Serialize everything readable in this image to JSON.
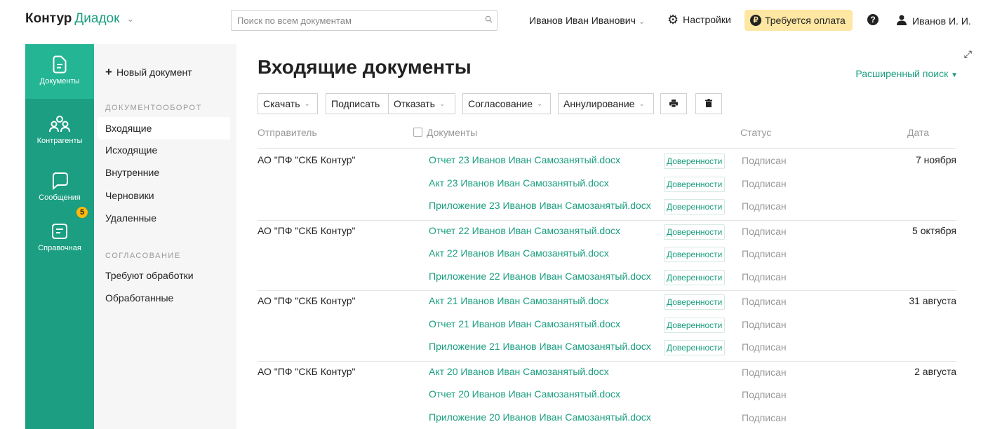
{
  "header": {
    "brand_main": "Контур",
    "brand_sub": "Диадок",
    "search_placeholder": "Поиск по всем документам",
    "org_user": "Иванов Иван Иванович",
    "settings_label": "Настройки",
    "payment_label": "Требуется оплата",
    "account_label": "Иванов И. И."
  },
  "nav": [
    {
      "label": "Документы",
      "icon": "document-icon"
    },
    {
      "label": "Контрагенты",
      "icon": "contacts-icon"
    },
    {
      "label": "Сообщения",
      "icon": "messages-icon"
    },
    {
      "label": "Справочная",
      "icon": "help-book-icon",
      "badge": "5"
    }
  ],
  "sidebar": {
    "new_doc": "Новый документ",
    "section1": "ДОКУМЕНТООБОРОТ",
    "items1": [
      "Входящие",
      "Исходящие",
      "Внутренние",
      "Черновики",
      "Удаленные"
    ],
    "section2": "СОГЛАСОВАНИЕ",
    "items2": [
      "Требуют обработки",
      "Обработанные"
    ]
  },
  "main": {
    "title": "Входящие документы",
    "advanced_search": "Расширенный поиск",
    "toolbar": {
      "download": "Скачать",
      "sign": "Подписать",
      "reject": "Отказать",
      "approval": "Согласование",
      "annul": "Аннулирование"
    },
    "columns": {
      "sender": "Отправитель",
      "documents": "Документы",
      "status": "Статус",
      "date": "Дата"
    },
    "groups": [
      {
        "sender": "АО \"ПФ \"СКБ Контур\"",
        "date": "7 ноября",
        "docs": [
          {
            "name": "Отчет 23 Иванов Иван Самозанятый.docx",
            "tag": "Доверенности",
            "status": "Подписан"
          },
          {
            "name": "Акт 23 Иванов Иван Самозанятый.docx",
            "tag": "Доверенности",
            "status": "Подписан"
          },
          {
            "name": "Приложение 23 Иванов Иван Самозанятый.docx",
            "tag": "Доверенности",
            "status": "Подписан"
          }
        ]
      },
      {
        "sender": "АО \"ПФ \"СКБ Контур\"",
        "date": "5 октября",
        "docs": [
          {
            "name": "Отчет 22 Иванов Иван Самозанятый.docx",
            "tag": "Доверенности",
            "status": "Подписан"
          },
          {
            "name": "Акт 22 Иванов Иван Самозанятый.docx",
            "tag": "Доверенности",
            "status": "Подписан"
          },
          {
            "name": "Приложение 22 Иванов Иван Самозанятый.docx",
            "tag": "Доверенности",
            "status": "Подписан"
          }
        ]
      },
      {
        "sender": "АО \"ПФ \"СКБ Контур\"",
        "date": "31 августа",
        "docs": [
          {
            "name": "Акт 21 Иванов Иван Самозанятый.docx",
            "tag": "Доверенности",
            "status": "Подписан"
          },
          {
            "name": "Отчет 21 Иванов Иван Самозанятый.docx",
            "tag": "Доверенности",
            "status": "Подписан"
          },
          {
            "name": "Приложение 21 Иванов Иван Самозанятый.docx",
            "tag": "Доверенности",
            "status": "Подписан"
          }
        ]
      },
      {
        "sender": "АО \"ПФ \"СКБ Контур\"",
        "date": "2 августа",
        "docs": [
          {
            "name": "Акт 20 Иванов Иван Самозанятый.docx",
            "tag": "",
            "status": "Подписан"
          },
          {
            "name": "Отчет 20 Иванов Иван Самозанятый.docx",
            "tag": "",
            "status": "Подписан"
          },
          {
            "name": "Приложение 20 Иванов Иван Самозанятый.docx",
            "tag": "",
            "status": "Подписан"
          }
        ]
      }
    ]
  },
  "colors": {
    "accent": "#1b9e81",
    "nav_bg": "#1b9e81",
    "nav_active": "#23b594",
    "payment_bg": "#fde7a2",
    "badge": "#ffb80b"
  }
}
